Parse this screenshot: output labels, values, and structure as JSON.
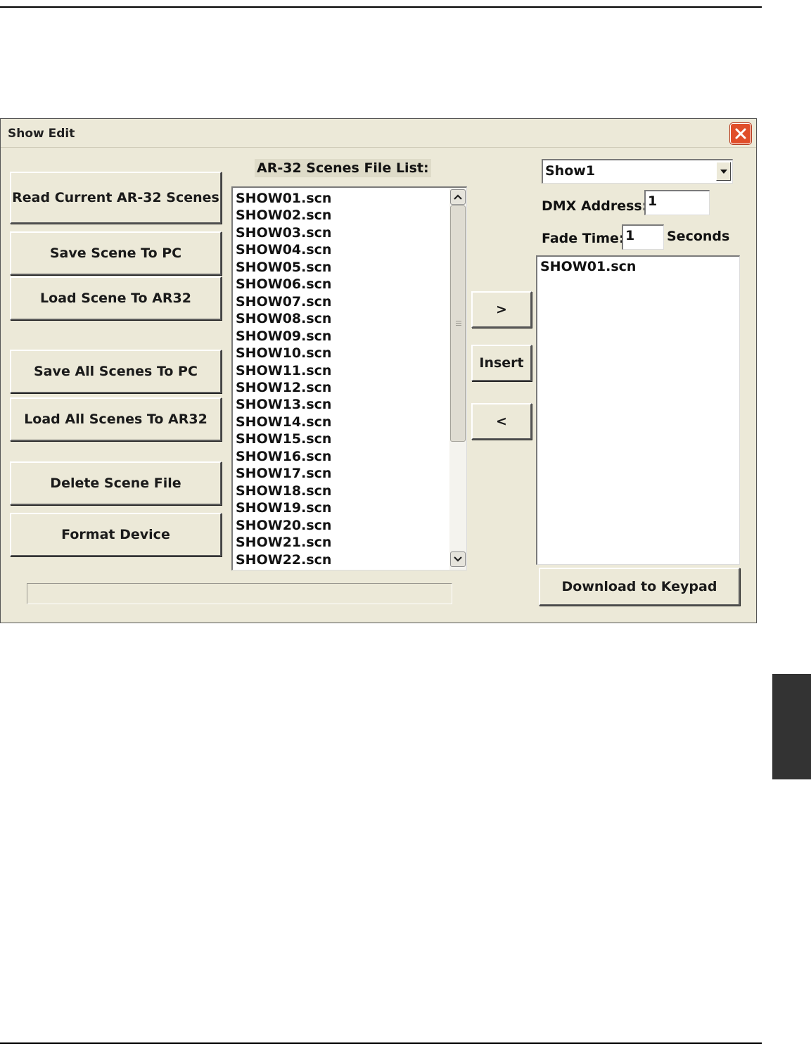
{
  "window": {
    "title": "Show Edit"
  },
  "left_buttons": [
    {
      "label": "Read Current AR-32 Scenes"
    },
    {
      "label": "Save Scene To PC"
    },
    {
      "label": "Load Scene To AR32"
    },
    {
      "label": "Save All Scenes To PC"
    },
    {
      "label": "Load All Scenes To AR32"
    },
    {
      "label": "Delete Scene File"
    },
    {
      "label": "Format Device"
    }
  ],
  "file_list": {
    "label": "AR-32 Scenes File List:",
    "items": [
      "SHOW01.scn",
      "SHOW02.scn",
      "SHOW03.scn",
      "SHOW04.scn",
      "SHOW05.scn",
      "SHOW06.scn",
      "SHOW07.scn",
      "SHOW08.scn",
      "SHOW09.scn",
      "SHOW10.scn",
      "SHOW11.scn",
      "SHOW12.scn",
      "SHOW13.scn",
      "SHOW14.scn",
      "SHOW15.scn",
      "SHOW16.scn",
      "SHOW17.scn",
      "SHOW18.scn",
      "SHOW19.scn",
      "SHOW20.scn",
      "SHOW21.scn",
      "SHOW22.scn"
    ]
  },
  "transfer_buttons": {
    "add": ">",
    "insert": "Insert",
    "remove": "<"
  },
  "show": {
    "selected": "Show1",
    "dmx_label": "DMX Address:",
    "dmx_value": "1",
    "fade_label": "Fade Time:",
    "fade_value": "1",
    "fade_unit": "Seconds",
    "items": [
      "SHOW01.scn"
    ],
    "download_label": "Download to Keypad"
  },
  "icons": {
    "close": "close-icon",
    "dropdown": "chevron-down-icon",
    "scroll_up": "arrow-up-icon",
    "scroll_down": "arrow-down-icon"
  }
}
